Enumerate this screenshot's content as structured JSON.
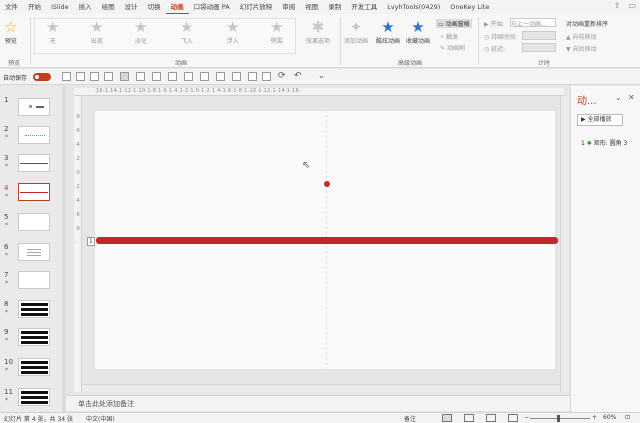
{
  "tabs": [
    "文件",
    "开始",
    "iSlide",
    "插入",
    "绘图",
    "设计",
    "切换",
    "动画",
    "口袋动画 PA",
    "幻灯片放映",
    "审阅",
    "视图",
    "录制",
    "开发工具",
    "LvyhTools(0429)",
    "OneKey Lite"
  ],
  "active_tab": "动画",
  "ribbon": {
    "preview": {
      "label": "预览",
      "group": "预览"
    },
    "effects": [
      {
        "label": "无",
        "icon": "star-icon"
      },
      {
        "label": "出现",
        "icon": "star-icon"
      },
      {
        "label": "淡化",
        "icon": "star-icon"
      },
      {
        "label": "飞入",
        "icon": "star-icon"
      },
      {
        "label": "浮入",
        "icon": "star-icon"
      },
      {
        "label": "劈裂",
        "icon": "star-icon"
      }
    ],
    "effect_options": "效果选项",
    "animation_group": "动画",
    "add_animation": "添加动画",
    "painter_animation": "酷炫动画",
    "collect_animation": "收藏动画",
    "animation_pane": "动画窗格",
    "trigger": "触发",
    "animation_painter": "动画刷",
    "advanced_group": "高级动画",
    "start_label": "开始:",
    "start_value": "与上一动画...",
    "duration_label": "持续时间:",
    "delay_label": "延迟:",
    "reorder_title": "对动画重新排序",
    "move_earlier": "向前移动",
    "move_later": "向后移动",
    "timing_group": "计时"
  },
  "qbar": {
    "autosave": "自动保存"
  },
  "thumbnails": [
    {
      "num": "1",
      "star": ""
    },
    {
      "num": "2",
      "star": "*"
    },
    {
      "num": "3",
      "star": "*"
    },
    {
      "num": "4",
      "star": "*"
    },
    {
      "num": "5",
      "star": "*"
    },
    {
      "num": "6",
      "star": "*"
    },
    {
      "num": "7",
      "star": "*"
    },
    {
      "num": "8",
      "star": "*"
    },
    {
      "num": "9",
      "star": "*"
    },
    {
      "num": "10",
      "star": "*"
    },
    {
      "num": "11",
      "star": "*"
    }
  ],
  "ruler": {
    "h": "·16·1·14·1·12·1·10·1·8·1·6·1·4·1·2·1·0·1·2·1·4·1·6·1·8·1·10·1·12·1·14·1·16·",
    "v": "·8·6·4·2·0·2·4·6·8·"
  },
  "canvas": {
    "anim_marker": "1"
  },
  "notes": {
    "placeholder": "单击此处添加备注"
  },
  "anim_pane": {
    "title": "动...",
    "play_all": "全部播放",
    "item_num": "1",
    "item_label": "矩形: 圆角 3"
  },
  "status": {
    "slide_info": "幻灯片 第 4 张，共 34 张",
    "language": "中文(中国)",
    "notes_btn": "备注",
    "zoom": "60%"
  },
  "colors": {
    "accent": "#c43e1c",
    "bar": "#c0282d"
  }
}
